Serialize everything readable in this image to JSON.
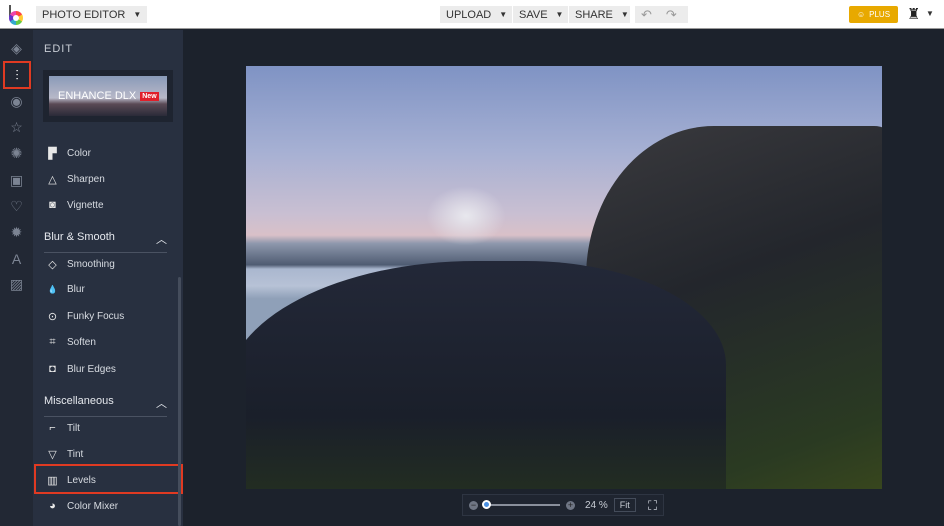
{
  "header": {
    "app_menu": "PHOTO EDITOR",
    "upload": "UPLOAD",
    "save": "SAVE",
    "share": "SHARE",
    "plus": "PLUS"
  },
  "panel": {
    "title": "EDIT",
    "banner_title": "ENHANCE DLX",
    "banner_badge": "New",
    "items_top": [
      {
        "label": "Color",
        "icon": "▛"
      },
      {
        "label": "Sharpen",
        "icon": "△"
      },
      {
        "label": "Vignette",
        "icon": "◙"
      }
    ],
    "sections": [
      {
        "title": "Blur & Smooth",
        "items": [
          {
            "label": "Smoothing",
            "icon": "◇"
          },
          {
            "label": "Blur",
            "icon": "💧"
          },
          {
            "label": "Funky Focus",
            "icon": "⊙"
          },
          {
            "label": "Soften",
            "icon": "⌗"
          },
          {
            "label": "Blur Edges",
            "icon": "◘"
          }
        ]
      },
      {
        "title": "Miscellaneous",
        "items": [
          {
            "label": "Tilt",
            "icon": "⌐"
          },
          {
            "label": "Tint",
            "icon": "▽"
          },
          {
            "label": "Levels",
            "icon": "▥"
          },
          {
            "label": "Color Mixer",
            "icon": "◕"
          }
        ]
      }
    ]
  },
  "zoom": {
    "value": "24 %",
    "fit": "Fit",
    "percent": 24
  }
}
